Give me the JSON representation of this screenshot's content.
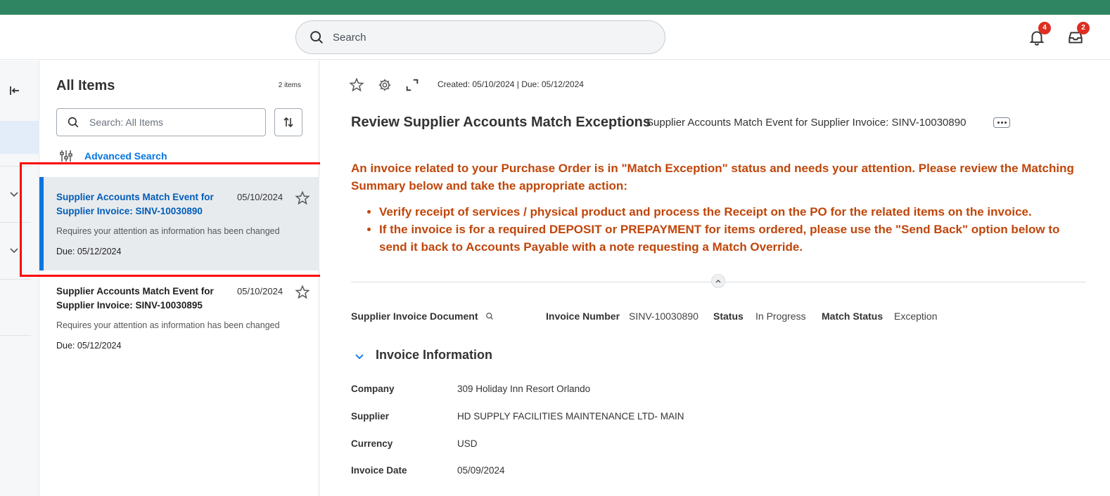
{
  "header": {
    "search_placeholder": "Search",
    "notifications_count": "4",
    "inbox_count": "2",
    "accent_color": "#2f8461"
  },
  "list": {
    "title": "All Items",
    "count": "2 items",
    "search_placeholder": "Search: All Items",
    "advanced_search": "Advanced Search",
    "items": [
      {
        "title": "Supplier Accounts Match Event for Supplier Invoice: SINV-10030890",
        "date": "05/10/2024",
        "description": "Requires your attention as information has been changed",
        "due": "Due: 05/12/2024"
      },
      {
        "title": "Supplier Accounts Match Event for Supplier Invoice: SINV-10030895",
        "date": "05/10/2024",
        "description": "Requires your attention as information has been changed",
        "due": "Due: 05/12/2024"
      }
    ]
  },
  "main": {
    "created_due": "Created: 05/10/2024 | Due: 05/12/2024",
    "title": "Review Supplier Accounts Match Exceptions",
    "subtitle": "Supplier Accounts Match Event for Supplier Invoice: SINV-10030890",
    "alert": {
      "intro": "An invoice related to your Purchase Order is in \"Match Exception\" status and needs your attention.  Please review the Matching Summary below and take the appropriate action:",
      "bullets": [
        "Verify receipt of services / physical product and process the Receipt on the PO for the related items on the invoice.",
        "If the invoice is for a required DEPOSIT or PREPAYMENT for items ordered, please use the \"Send Back\" option below to send it back to Accounts Payable with a note requesting a Match Override."
      ],
      "color": "#c0460a"
    },
    "fields": {
      "supplier_invoice_document_label": "Supplier Invoice Document",
      "invoice_number_label": "Invoice Number",
      "invoice_number_value": "SINV-10030890",
      "status_label": "Status",
      "status_value": "In Progress",
      "match_status_label": "Match Status",
      "match_status_value": "Exception"
    },
    "invoice_info": {
      "section_title": "Invoice Information",
      "rows": [
        {
          "label": "Company",
          "value": "309 Holiday Inn Resort Orlando"
        },
        {
          "label": "Supplier",
          "value": "HD SUPPLY FACILITIES MAINTENANCE LTD- MAIN"
        },
        {
          "label": "Currency",
          "value": "USD"
        },
        {
          "label": "Invoice Date",
          "value": "05/09/2024"
        }
      ]
    }
  }
}
